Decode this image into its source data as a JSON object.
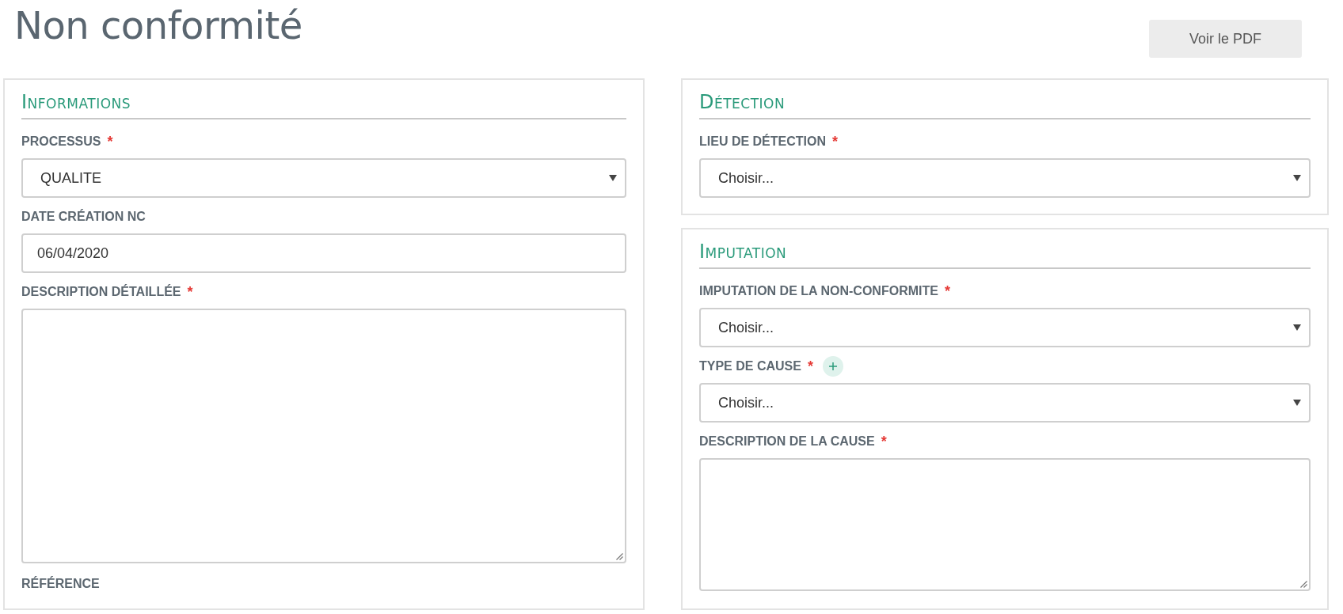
{
  "page": {
    "title": "Non conformité",
    "pdf_button": "Voir le PDF"
  },
  "columns": [
    {
      "sections": [
        {
          "title": "Informations",
          "fields": [
            {
              "label": "PROCESSUS",
              "required_mark": "*",
              "kind": "select",
              "value": "QUALITE"
            },
            {
              "label": "DATE CRÉATION NC",
              "kind": "input",
              "value": "06/04/2020"
            },
            {
              "label": "DESCRIPTION DÉTAILLÉE",
              "required_mark": "*",
              "kind": "long_text"
            },
            {
              "label": "RÉFÉRENCE",
              "kind": "label"
            }
          ]
        }
      ]
    },
    {
      "sections": [
        {
          "title": "Détection",
          "fields": [
            {
              "label": "LIEU DE DÉTECTION",
              "required_mark": "*",
              "kind": "select",
              "value": "Choisir..."
            }
          ]
        },
        {
          "title": "Imputation",
          "fields": [
            {
              "label": "IMPUTATION DE LA NON-CONFORMITE",
              "required_mark": "*",
              "kind": "select",
              "value": "Choisir..."
            },
            {
              "label": "TYPE DE CAUSE",
              "required_mark": "*",
              "add_button": true,
              "kind": "select",
              "value": "Choisir..."
            },
            {
              "label": "DESCRIPTION DE LA CAUSE",
              "required_mark": "*",
              "kind": "short_text"
            }
          ]
        }
      ]
    }
  ]
}
